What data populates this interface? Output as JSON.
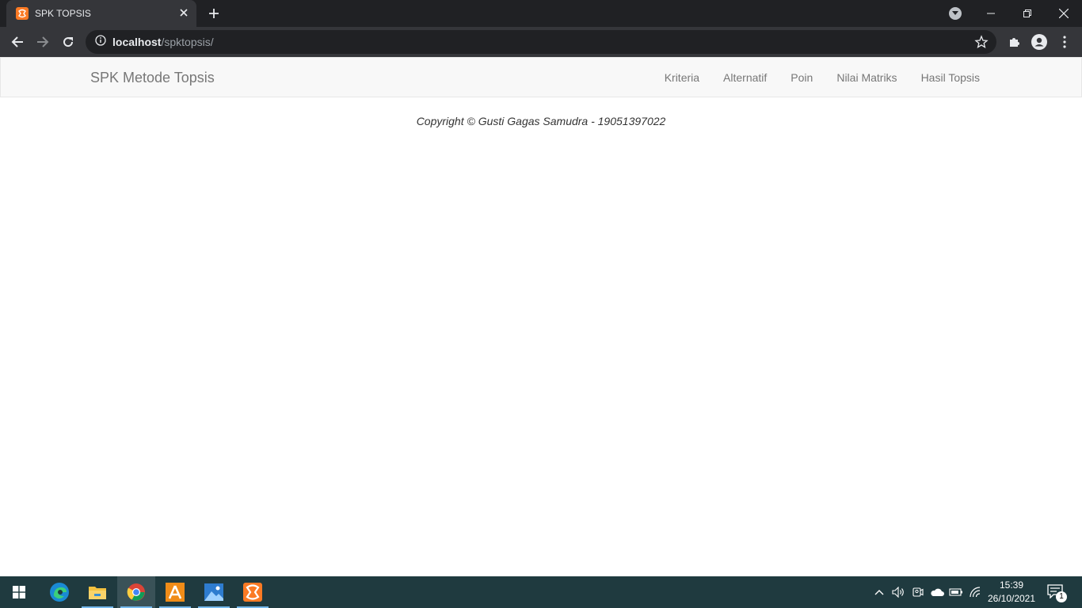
{
  "browser": {
    "tab_title": "SPK TOPSIS",
    "url_host": "localhost",
    "url_path": "/spktopsis/"
  },
  "navbar": {
    "brand": "SPK Metode Topsis",
    "links": [
      "Kriteria",
      "Alternatif",
      "Poin",
      "Nilai Matriks",
      "Hasil Topsis"
    ]
  },
  "footer": {
    "copyright": "Copyright © Gusti Gagas Samudra - 19051397022"
  },
  "taskbar": {
    "apps": [
      "edge-icon",
      "file-explorer-icon",
      "chrome-icon",
      "app-orange-icon",
      "photos-icon",
      "xampp-icon"
    ],
    "time": "15:39",
    "date": "26/10/2021",
    "notification_count": "1"
  },
  "colors": {
    "chrome_dark": "#202124",
    "chrome_toolbar": "#35363a",
    "navbar_bg": "#f8f8f8",
    "link": "#777777",
    "taskbar": "#1f3a3f",
    "xampp_orange": "#fb7a24"
  }
}
